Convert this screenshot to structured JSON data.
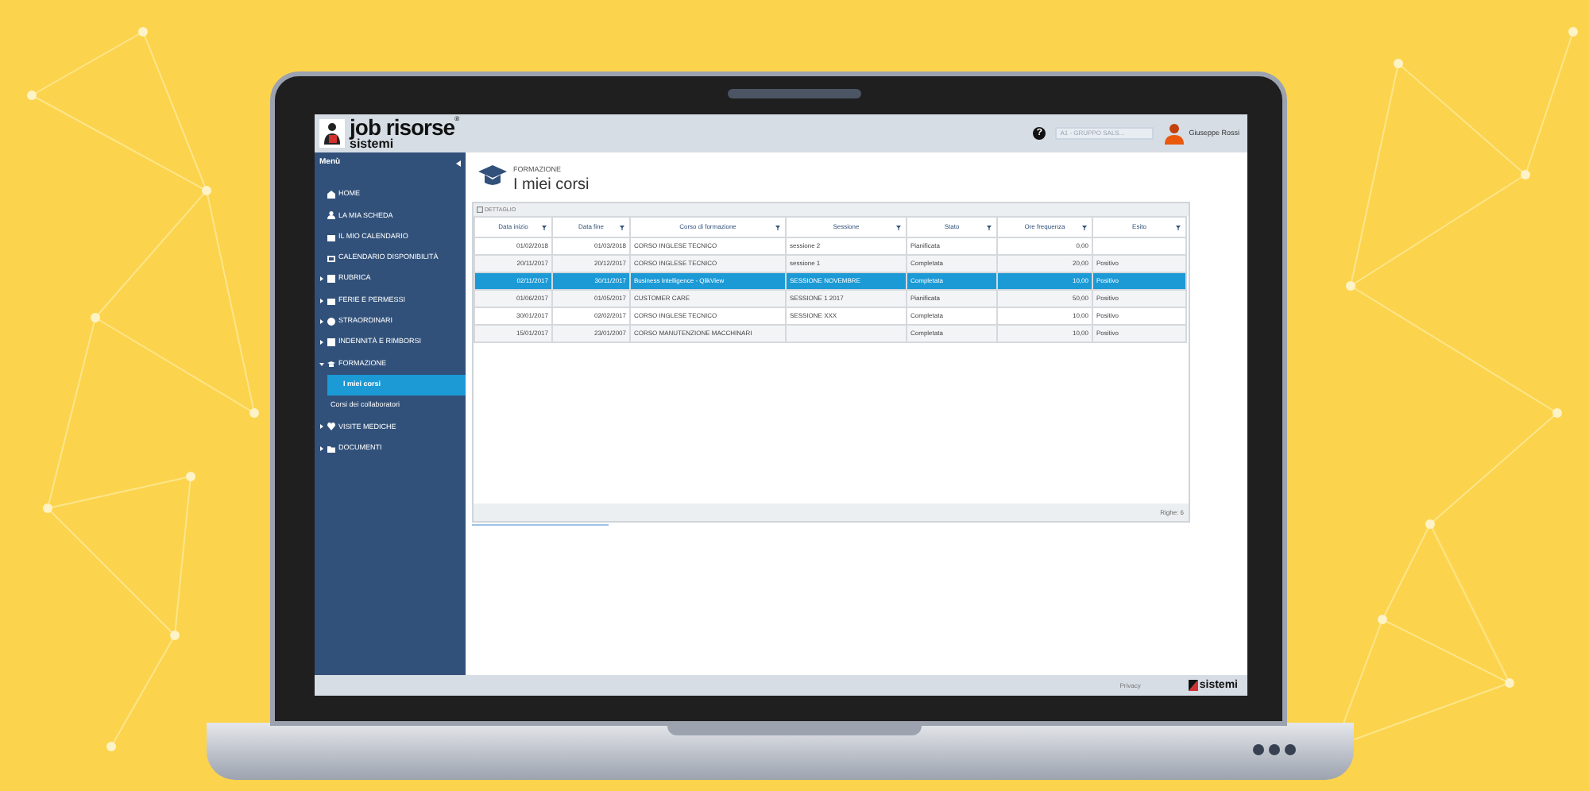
{
  "header": {
    "logo_title": "job risorse",
    "logo_mark": "®",
    "logo_sub": "sistemi",
    "help": "?",
    "company_select": {
      "value": "A1 - GRUPPO SALS..."
    },
    "user": "Giuseppe Rossi"
  },
  "sidebar": {
    "title": "Menù",
    "items": [
      {
        "label": "HOME",
        "kind": "link"
      },
      {
        "label": "LA MIA SCHEDA",
        "kind": "link"
      },
      {
        "label": "IL MIO CALENDARIO",
        "kind": "link"
      },
      {
        "label": "CALENDARIO DISPONIBILITÀ",
        "kind": "link"
      },
      {
        "label": "RUBRICA",
        "kind": "group",
        "expanded": false
      },
      {
        "label": "FERIE E PERMESSI",
        "kind": "group",
        "expanded": false
      },
      {
        "label": "STRAORDINARI",
        "kind": "group",
        "expanded": false
      },
      {
        "label": "INDENNITÀ E RIMBORSI",
        "kind": "group",
        "expanded": false
      },
      {
        "label": "FORMAZIONE",
        "kind": "group",
        "expanded": true,
        "children": [
          {
            "label": "I miei corsi",
            "selected": true
          },
          {
            "label": "Corsi dei collaboratori",
            "selected": false
          }
        ]
      },
      {
        "label": "VISITE MEDICHE",
        "kind": "group",
        "expanded": false
      },
      {
        "label": "DOCUMENTI",
        "kind": "group",
        "expanded": false
      }
    ]
  },
  "page": {
    "breadcrumb": "FORMAZIONE",
    "title": "I miei corsi",
    "panel_label": "DETTAGLIO",
    "table": {
      "columns": [
        "Data inizio",
        "Data fine",
        "Corso di formazione",
        "Sessione",
        "Stato",
        "Ore frequenza",
        "Esito"
      ],
      "rows": [
        {
          "selected": false,
          "cells": [
            "01/02/2018",
            "01/03/2018",
            "CORSO INGLESE TECNICO",
            "sessione 2",
            "Pianificata",
            "0,00",
            ""
          ]
        },
        {
          "selected": false,
          "cells": [
            "20/11/2017",
            "20/12/2017",
            "CORSO INGLESE TECNICO",
            "sessione 1",
            "Completata",
            "20,00",
            "Positivo"
          ]
        },
        {
          "selected": true,
          "cells": [
            "02/11/2017",
            "30/11/2017",
            "Business Intelligence - QlikView",
            "SESSIONE NOVEMBRE",
            "Completata",
            "10,00",
            "Positivo"
          ]
        },
        {
          "selected": false,
          "cells": [
            "01/06/2017",
            "01/05/2017",
            "CUSTOMER CARE",
            "SESSIONE 1 2017",
            "Pianificata",
            "50,00",
            "Positivo"
          ]
        },
        {
          "selected": false,
          "cells": [
            "30/01/2017",
            "02/02/2017",
            "CORSO INGLESE TECNICO",
            "SESSIONE XXX",
            "Completata",
            "10,00",
            "Positivo"
          ]
        },
        {
          "selected": false,
          "cells": [
            "15/01/2017",
            "23/01/2007",
            "CORSO MANUTENZIONE MACCHINARI",
            "",
            "Completata",
            "10,00",
            "Positivo"
          ]
        }
      ]
    },
    "row_count": "Righe: 6"
  },
  "footer": {
    "privacy": "Privacy",
    "brand": "sistemi"
  }
}
